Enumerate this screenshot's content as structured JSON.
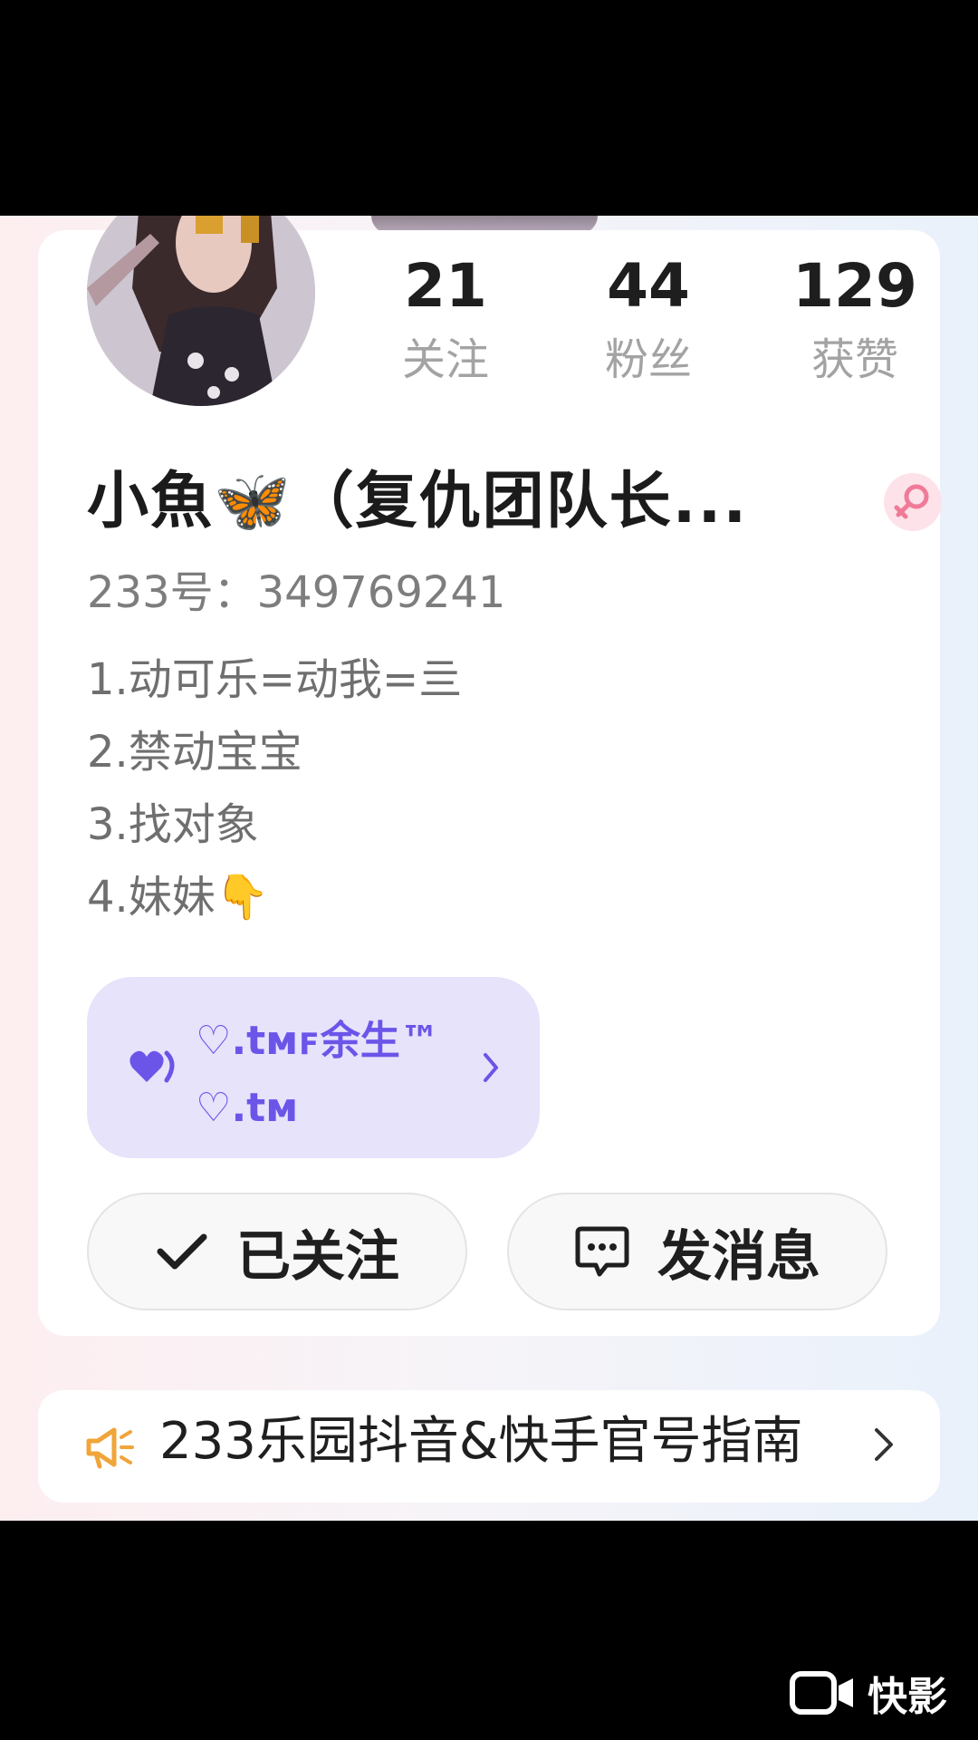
{
  "profile": {
    "stats": [
      {
        "value": "21",
        "label": "关注"
      },
      {
        "value": "44",
        "label": "粉丝"
      },
      {
        "value": "129",
        "label": "获赞"
      }
    ],
    "name": "小魚🦋（复仇团队长...",
    "id_line": "233号：349769241",
    "bio": [
      "1.动可乐=动我=亖",
      "2.禁动宝宝",
      "3.找对象",
      "4.妹妹👇"
    ],
    "relation": {
      "line1": "♡.tᴍꜰ余生™",
      "line2": "♡.tᴍ"
    },
    "follow_button": "已关注",
    "message_button": "发消息",
    "gender_icon": "female-icon"
  },
  "notice": {
    "text": "233乐园抖音&快手官号指南"
  },
  "watermark": {
    "text": "快影"
  },
  "colors": {
    "accent_purple": "#6b55e8",
    "notice_orange": "#f0a53a",
    "female_pink": "#f07b98"
  }
}
